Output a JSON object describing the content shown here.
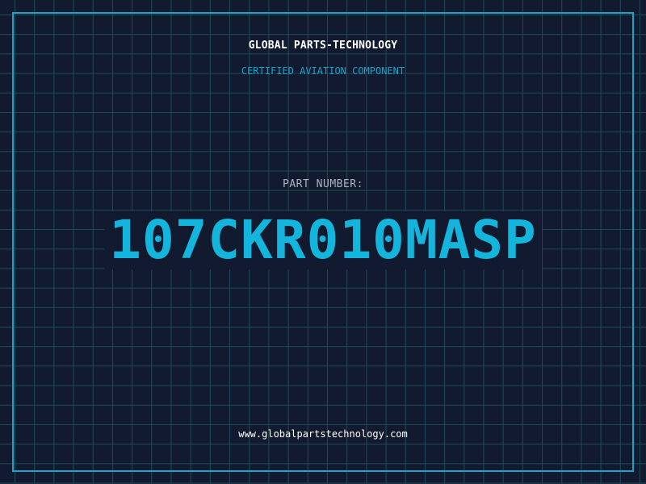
{
  "header": {
    "company": "GLOBAL PARTS-TECHNOLOGY",
    "tagline": "CERTIFIED AVIATION COMPONENT"
  },
  "part": {
    "label": "PART NUMBER:",
    "number": "107CKR010MASP"
  },
  "footer": {
    "website": "www.globalpartstechnology.com"
  },
  "colors": {
    "background": "#111a2e",
    "grid": "#1f4a5a",
    "accent": "#1aa3c9",
    "part_number": "#14b5dd",
    "text": "#ffffff",
    "label": "#aab4c2"
  }
}
